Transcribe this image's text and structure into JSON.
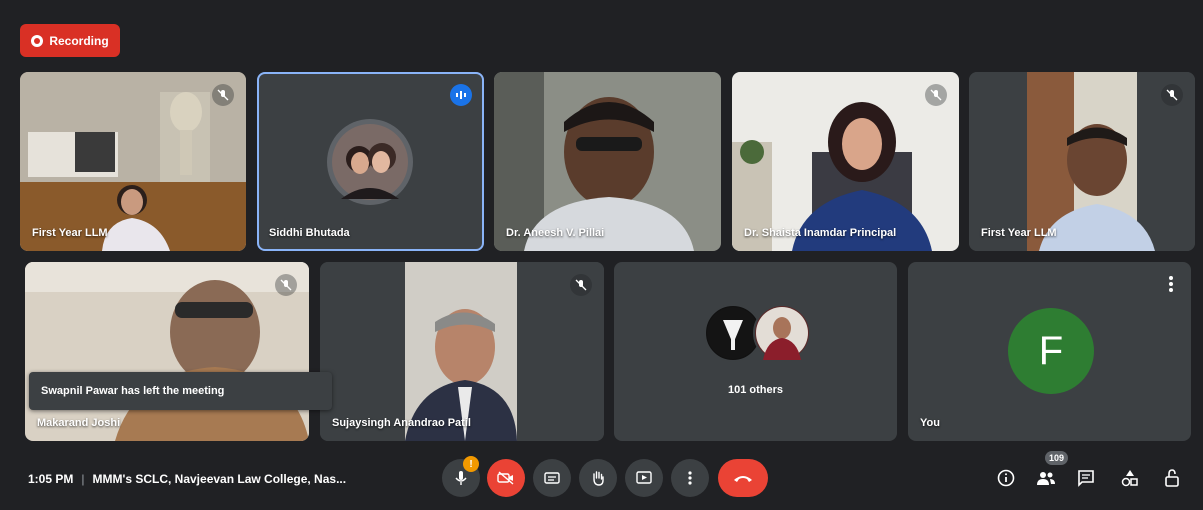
{
  "recording": {
    "label": "Recording"
  },
  "participants": [
    {
      "name": "First Year LLM"
    },
    {
      "name": "Siddhi Bhutada"
    },
    {
      "name": "Dr. Aneesh V. Pillai"
    },
    {
      "name": "Dr. Shaista Inamdar Principal"
    },
    {
      "name": "First Year LLM"
    },
    {
      "name": "Makarand Joshi"
    },
    {
      "name": "Sujaysingh Anandrao Patil"
    },
    {
      "name": "101 others"
    },
    {
      "name": "You",
      "initial": "F"
    }
  ],
  "toast": {
    "text": "Swapnil Pawar has left the meeting"
  },
  "meeting": {
    "time": "1:05 PM",
    "separator": "|",
    "title": "MMM's SCLC, Navjeevan Law College, Nas..."
  },
  "controls": {
    "mic_badge": "!"
  },
  "people_count": "109",
  "icons": [
    "record-icon",
    "mic-off-icon",
    "speaking-icon",
    "more-vert-icon",
    "camera-off-icon",
    "captions-icon",
    "raise-hand-icon",
    "present-icon",
    "end-call-icon",
    "info-icon",
    "people-icon",
    "chat-icon",
    "activities-icon",
    "host-controls-icon"
  ],
  "colors": {
    "background": "#202124",
    "tile": "#3c4043",
    "red": "#ea4335",
    "recording": "#d93025",
    "speaking_blue": "#1a73e8",
    "avatar_green": "#2e7d32"
  }
}
